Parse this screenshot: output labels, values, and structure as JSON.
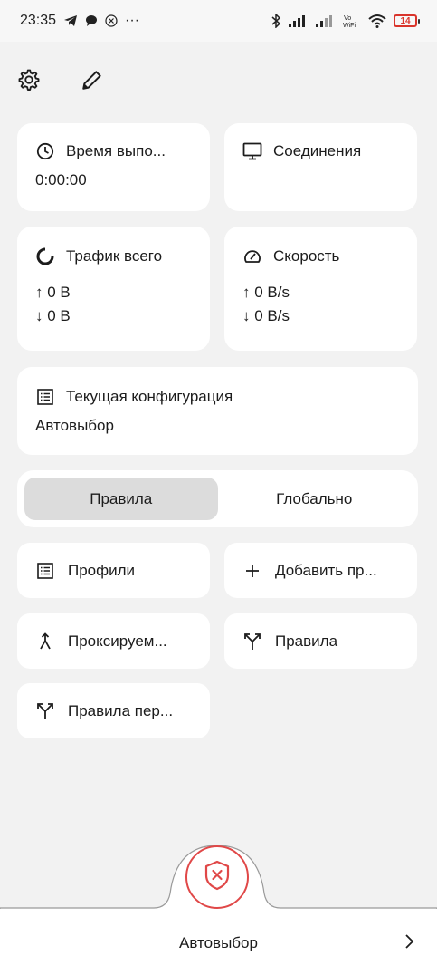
{
  "status_bar": {
    "time": "23:35",
    "more": "···",
    "battery": "14"
  },
  "stats": {
    "uptime": {
      "label": "Время выпо...",
      "value": "0:00:00"
    },
    "connections": {
      "label": "Соединения"
    },
    "traffic": {
      "label": "Трафик всего",
      "up": "↑ 0 B",
      "down": "↓ 0 B"
    },
    "speed": {
      "label": "Скорость",
      "up": "↑ 0 B/s",
      "down": "↓ 0 B/s"
    }
  },
  "config": {
    "label": "Текущая конфигурация",
    "value": "Автовыбор"
  },
  "mode": {
    "rules": "Правила",
    "global": "Глобально",
    "selected": "rules"
  },
  "tiles": {
    "profiles": "Профили",
    "add_profile": "Добавить пр...",
    "proxied": "Проксируем...",
    "rules": "Правила",
    "rules_override": "Правила пер..."
  },
  "bottom": {
    "profile": "Автовыбор"
  },
  "colors": {
    "accent": "#e04848",
    "card": "#ffffff",
    "background": "#f2f2f2",
    "segment_active": "#dcdcdc"
  }
}
